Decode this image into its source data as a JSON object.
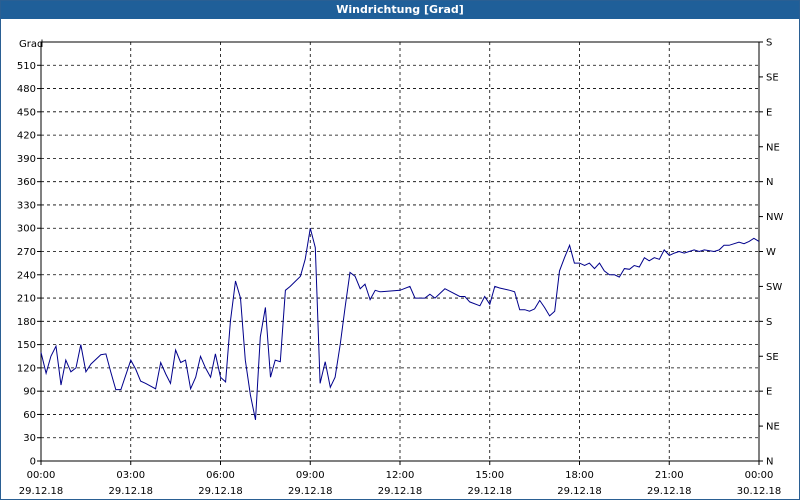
{
  "window": {
    "title": "Windrichtung [Grad]"
  },
  "chart_data": {
    "type": "line",
    "title": "Windrichtung [Grad]",
    "ylabel": "Grad",
    "ylim": [
      0,
      540
    ],
    "yticks": [
      0,
      30,
      60,
      90,
      120,
      150,
      180,
      210,
      240,
      270,
      300,
      330,
      360,
      390,
      420,
      450,
      480,
      510
    ],
    "right_axis_labels": [
      {
        "deg": 0,
        "label": "N"
      },
      {
        "deg": 45,
        "label": "NE"
      },
      {
        "deg": 90,
        "label": "E"
      },
      {
        "deg": 135,
        "label": "SE"
      },
      {
        "deg": 180,
        "label": "S"
      },
      {
        "deg": 225,
        "label": "SW"
      },
      {
        "deg": 270,
        "label": "W"
      },
      {
        "deg": 315,
        "label": "NW"
      },
      {
        "deg": 360,
        "label": "N"
      },
      {
        "deg": 405,
        "label": "NE"
      },
      {
        "deg": 450,
        "label": "E"
      },
      {
        "deg": 495,
        "label": "SE"
      },
      {
        "deg": 540,
        "label": "S"
      }
    ],
    "x_domain_hours": [
      0,
      24
    ],
    "x_ticks": [
      {
        "h": 0,
        "time": "00:00",
        "date": "29.12.18"
      },
      {
        "h": 3,
        "time": "03:00",
        "date": "29.12.18"
      },
      {
        "h": 6,
        "time": "06:00",
        "date": "29.12.18"
      },
      {
        "h": 9,
        "time": "09:00",
        "date": "29.12.18"
      },
      {
        "h": 12,
        "time": "12:00",
        "date": "29.12.18"
      },
      {
        "h": 15,
        "time": "15:00",
        "date": "29.12.18"
      },
      {
        "h": 18,
        "time": "18:00",
        "date": "29.12.18"
      },
      {
        "h": 21,
        "time": "21:00",
        "date": "29.12.18"
      },
      {
        "h": 24,
        "time": "00:00",
        "date": "30.12.18"
      }
    ],
    "grid": true,
    "series": [
      {
        "color": "#00008b",
        "points": [
          [
            0.0,
            140
          ],
          [
            0.17,
            113
          ],
          [
            0.33,
            135
          ],
          [
            0.5,
            148
          ],
          [
            0.67,
            98
          ],
          [
            0.83,
            130
          ],
          [
            1.0,
            115
          ],
          [
            1.17,
            120
          ],
          [
            1.33,
            150
          ],
          [
            1.5,
            115
          ],
          [
            1.67,
            125
          ],
          [
            2.0,
            137
          ],
          [
            2.17,
            138
          ],
          [
            2.33,
            115
          ],
          [
            2.5,
            92
          ],
          [
            2.67,
            92
          ],
          [
            3.0,
            130
          ],
          [
            3.17,
            118
          ],
          [
            3.33,
            103
          ],
          [
            3.5,
            100
          ],
          [
            3.83,
            93
          ],
          [
            4.0,
            127
          ],
          [
            4.17,
            112
          ],
          [
            4.33,
            100
          ],
          [
            4.5,
            143
          ],
          [
            4.67,
            127
          ],
          [
            4.83,
            130
          ],
          [
            5.0,
            93
          ],
          [
            5.17,
            108
          ],
          [
            5.33,
            135
          ],
          [
            5.5,
            120
          ],
          [
            5.67,
            108
          ],
          [
            5.83,
            138
          ],
          [
            6.0,
            108
          ],
          [
            6.17,
            102
          ],
          [
            6.33,
            180
          ],
          [
            6.5,
            232
          ],
          [
            6.67,
            210
          ],
          [
            6.83,
            130
          ],
          [
            7.0,
            85
          ],
          [
            7.17,
            53
          ],
          [
            7.33,
            160
          ],
          [
            7.5,
            198
          ],
          [
            7.67,
            108
          ],
          [
            7.83,
            130
          ],
          [
            8.0,
            128
          ],
          [
            8.17,
            220
          ],
          [
            8.33,
            225
          ],
          [
            8.67,
            238
          ],
          [
            8.83,
            260
          ],
          [
            9.0,
            300
          ],
          [
            9.17,
            275
          ],
          [
            9.33,
            100
          ],
          [
            9.5,
            128
          ],
          [
            9.67,
            95
          ],
          [
            9.83,
            108
          ],
          [
            10.0,
            150
          ],
          [
            10.17,
            200
          ],
          [
            10.33,
            243
          ],
          [
            10.5,
            238
          ],
          [
            10.67,
            222
          ],
          [
            10.83,
            228
          ],
          [
            11.0,
            208
          ],
          [
            11.17,
            220
          ],
          [
            11.33,
            218
          ],
          [
            12.0,
            220
          ],
          [
            12.33,
            225
          ],
          [
            12.5,
            210
          ],
          [
            12.83,
            210
          ],
          [
            13.0,
            215
          ],
          [
            13.17,
            210
          ],
          [
            13.5,
            222
          ],
          [
            14.0,
            212
          ],
          [
            14.17,
            212
          ],
          [
            14.33,
            205
          ],
          [
            14.67,
            200
          ],
          [
            14.83,
            212
          ],
          [
            15.0,
            202
          ],
          [
            15.17,
            225
          ],
          [
            15.33,
            223
          ],
          [
            15.67,
            220
          ],
          [
            15.83,
            218
          ],
          [
            16.0,
            195
          ],
          [
            16.17,
            195
          ],
          [
            16.33,
            193
          ],
          [
            16.5,
            196
          ],
          [
            16.67,
            207
          ],
          [
            16.83,
            198
          ],
          [
            17.0,
            187
          ],
          [
            17.17,
            193
          ],
          [
            17.33,
            245
          ],
          [
            17.5,
            262
          ],
          [
            17.67,
            278
          ],
          [
            17.83,
            255
          ],
          [
            18.0,
            255
          ],
          [
            18.17,
            252
          ],
          [
            18.33,
            255
          ],
          [
            18.5,
            248
          ],
          [
            18.67,
            255
          ],
          [
            18.83,
            245
          ],
          [
            19.0,
            240
          ],
          [
            19.17,
            240
          ],
          [
            19.33,
            237
          ],
          [
            19.5,
            248
          ],
          [
            19.67,
            247
          ],
          [
            19.83,
            252
          ],
          [
            20.0,
            250
          ],
          [
            20.17,
            262
          ],
          [
            20.33,
            258
          ],
          [
            20.5,
            262
          ],
          [
            20.67,
            260
          ],
          [
            20.83,
            272
          ],
          [
            21.0,
            265
          ],
          [
            21.17,
            268
          ],
          [
            21.33,
            270
          ],
          [
            21.5,
            268
          ],
          [
            21.83,
            272
          ],
          [
            22.0,
            270
          ],
          [
            22.17,
            272
          ],
          [
            22.5,
            270
          ],
          [
            22.67,
            272
          ],
          [
            22.83,
            278
          ],
          [
            23.0,
            278
          ],
          [
            23.33,
            282
          ],
          [
            23.5,
            280
          ],
          [
            23.67,
            283
          ],
          [
            23.83,
            287
          ],
          [
            24.0,
            283
          ]
        ]
      }
    ]
  }
}
